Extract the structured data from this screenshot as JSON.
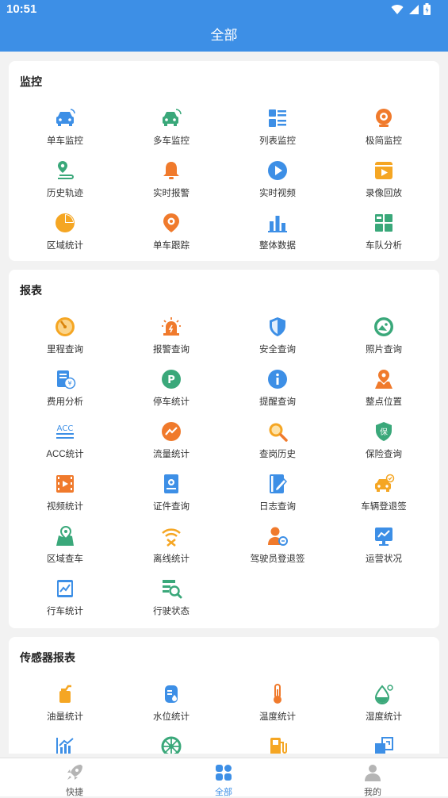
{
  "status": {
    "time": "10:51"
  },
  "header": {
    "title": "全部"
  },
  "sections": [
    {
      "title": "监控",
      "items": [
        {
          "label": "单车监控",
          "icon": "car-signal-icon"
        },
        {
          "label": "多车监控",
          "icon": "multi-car-icon"
        },
        {
          "label": "列表监控",
          "icon": "list-icon"
        },
        {
          "label": "极简监控",
          "icon": "webcam-icon"
        },
        {
          "label": "历史轨迹",
          "icon": "map-pin-track-icon"
        },
        {
          "label": "实时报警",
          "icon": "bell-icon"
        },
        {
          "label": "实时视频",
          "icon": "play-icon"
        },
        {
          "label": "录像回放",
          "icon": "video-playback-icon"
        },
        {
          "label": "区域统计",
          "icon": "pie-chart-icon"
        },
        {
          "label": "单车跟踪",
          "icon": "location-target-icon"
        },
        {
          "label": "整体数据",
          "icon": "bar-chart-icon"
        },
        {
          "label": "车队分析",
          "icon": "fleet-grid-icon"
        }
      ]
    },
    {
      "title": "报表",
      "items": [
        {
          "label": "里程查询",
          "icon": "speedometer-icon"
        },
        {
          "label": "报警查询",
          "icon": "alarm-light-icon"
        },
        {
          "label": "安全查询",
          "icon": "shield-icon"
        },
        {
          "label": "照片查询",
          "icon": "photo-icon"
        },
        {
          "label": "费用分析",
          "icon": "yen-document-icon"
        },
        {
          "label": "停车统计",
          "icon": "parking-icon"
        },
        {
          "label": "提醒查询",
          "icon": "info-icon"
        },
        {
          "label": "整点位置",
          "icon": "map-location-icon"
        },
        {
          "label": "ACC统计",
          "icon": "acc-icon"
        },
        {
          "label": "流量统计",
          "icon": "trend-icon"
        },
        {
          "label": "查岗历史",
          "icon": "magnifier-icon"
        },
        {
          "label": "保险查询",
          "icon": "insurance-shield-icon"
        },
        {
          "label": "视频统计",
          "icon": "film-icon"
        },
        {
          "label": "证件查询",
          "icon": "certificate-icon"
        },
        {
          "label": "日志查询",
          "icon": "log-icon"
        },
        {
          "label": "车辆登退签",
          "icon": "car-sign-icon"
        },
        {
          "label": "区域查车",
          "icon": "area-map-icon"
        },
        {
          "label": "离线统计",
          "icon": "wifi-off-icon"
        },
        {
          "label": "驾驶员登退签",
          "icon": "driver-icon"
        },
        {
          "label": "运营状况",
          "icon": "monitor-chart-icon"
        },
        {
          "label": "行车统计",
          "icon": "driving-chart-icon"
        },
        {
          "label": "行驶状态",
          "icon": "status-search-icon"
        }
      ]
    },
    {
      "title": "传感器报表",
      "items": [
        {
          "label": "油量统计",
          "icon": "oil-can-icon"
        },
        {
          "label": "水位统计",
          "icon": "water-tank-icon"
        },
        {
          "label": "温度统计",
          "icon": "thermometer-icon"
        },
        {
          "label": "湿度统计",
          "icon": "humidity-icon"
        },
        {
          "label": "",
          "icon": "line-chart-icon"
        },
        {
          "label": "",
          "icon": "wheel-icon"
        },
        {
          "label": "",
          "icon": "fuel-pump-icon"
        },
        {
          "label": "",
          "icon": "transfer-icon"
        }
      ]
    }
  ],
  "tabs": [
    {
      "label": "快捷",
      "icon": "rocket-icon"
    },
    {
      "label": "全部",
      "icon": "all-grid-icon"
    },
    {
      "label": "我的",
      "icon": "person-icon"
    }
  ],
  "colors": {
    "primary": "#3d8fe6",
    "green": "#3aa87a",
    "orange": "#f07a2c",
    "yellow": "#f5a623"
  }
}
